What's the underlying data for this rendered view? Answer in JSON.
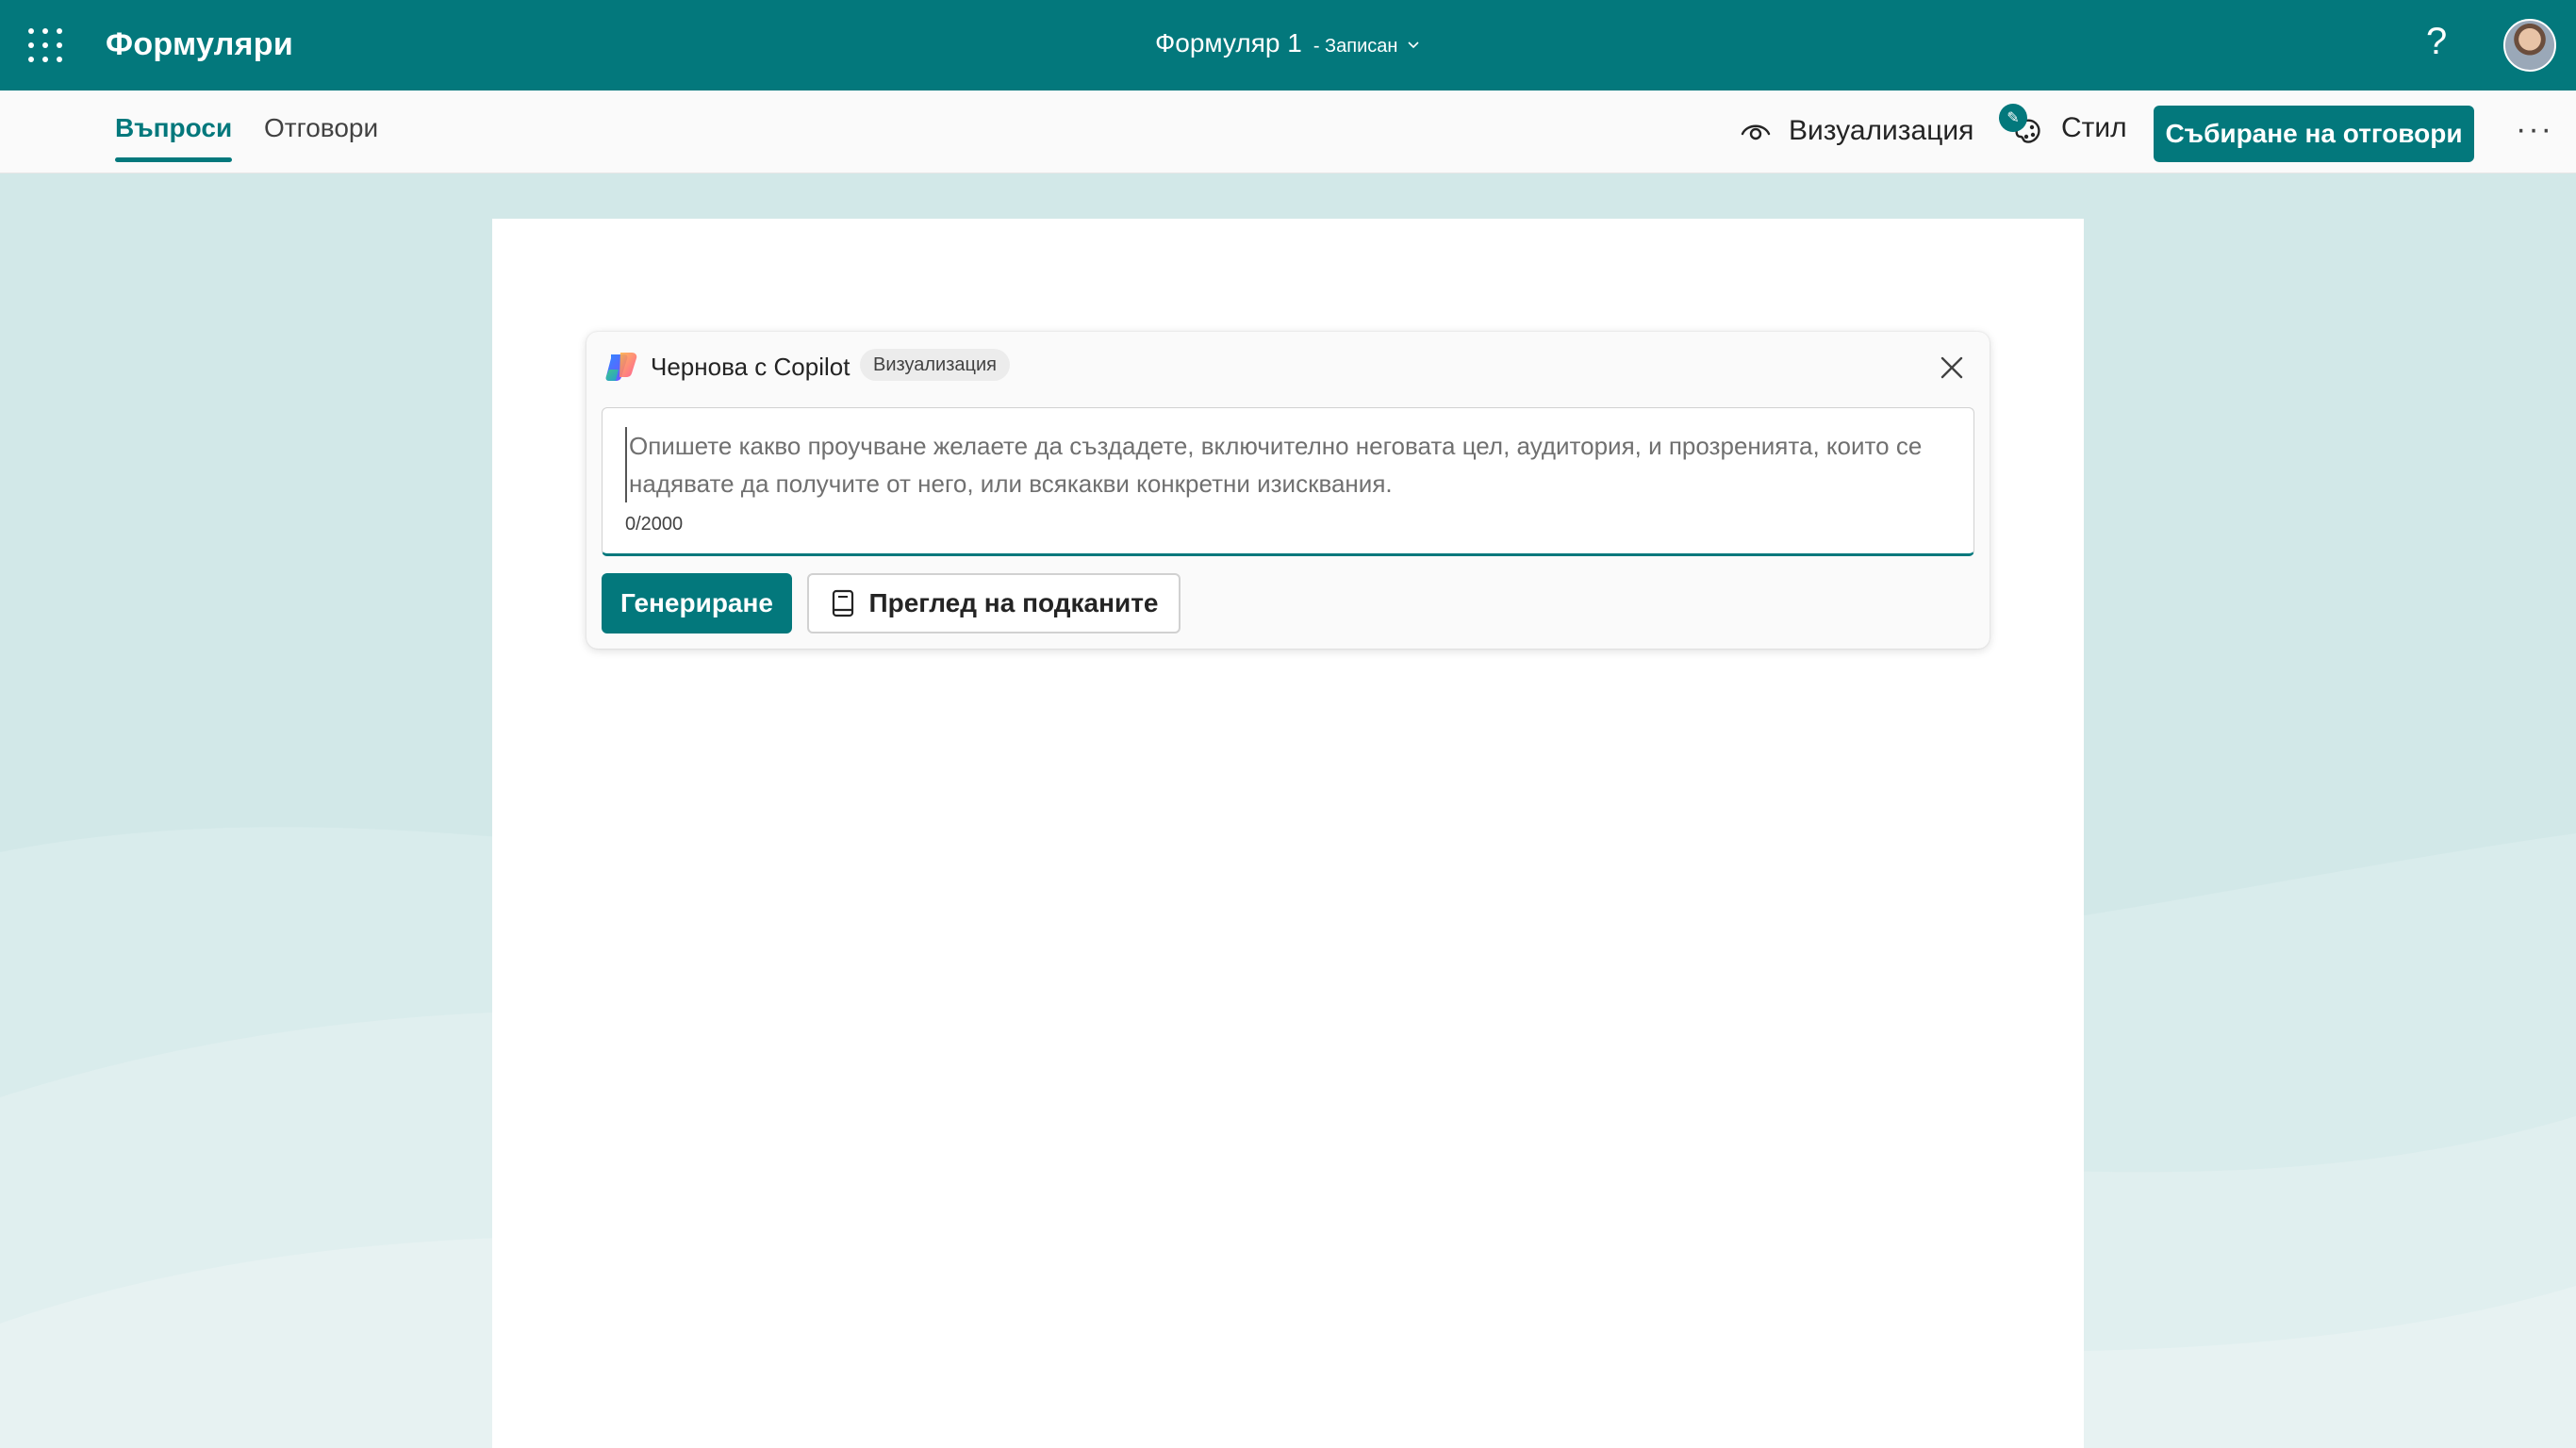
{
  "header": {
    "app_name": "Формуляри",
    "doc_title": "Формуляр 1",
    "doc_status": "- Записан",
    "help_label": "?"
  },
  "cmdbar": {
    "tabs": [
      {
        "label": "Въпроси",
        "active": true
      },
      {
        "label": "Отговори",
        "active": false
      }
    ],
    "preview_label": "Визуализация",
    "style_label": "Стил",
    "collect_label": "Събиране на отговори",
    "more_label": "···"
  },
  "copilot": {
    "title": "Чернова с Copilot",
    "badge": "Визуализация",
    "placeholder": "Опишете какво проучване желаете да създадете, включително неговата цел, аудитория, и прозренията, които се надявате да получите от него, или всякакви конкретни изисквания.",
    "value": "",
    "counter": "0/2000",
    "generate_label": "Генериране",
    "view_prompts_label": "Преглед на подканите"
  },
  "colors": {
    "accent": "#03787c",
    "background": "#d9ebeb",
    "canvas": "#ffffff"
  },
  "icons": [
    "waffle-icon",
    "chevron-down-icon",
    "help-icon",
    "eye-icon",
    "palette-icon",
    "copilot-icon",
    "close-icon",
    "book-icon",
    "more-icon"
  ]
}
